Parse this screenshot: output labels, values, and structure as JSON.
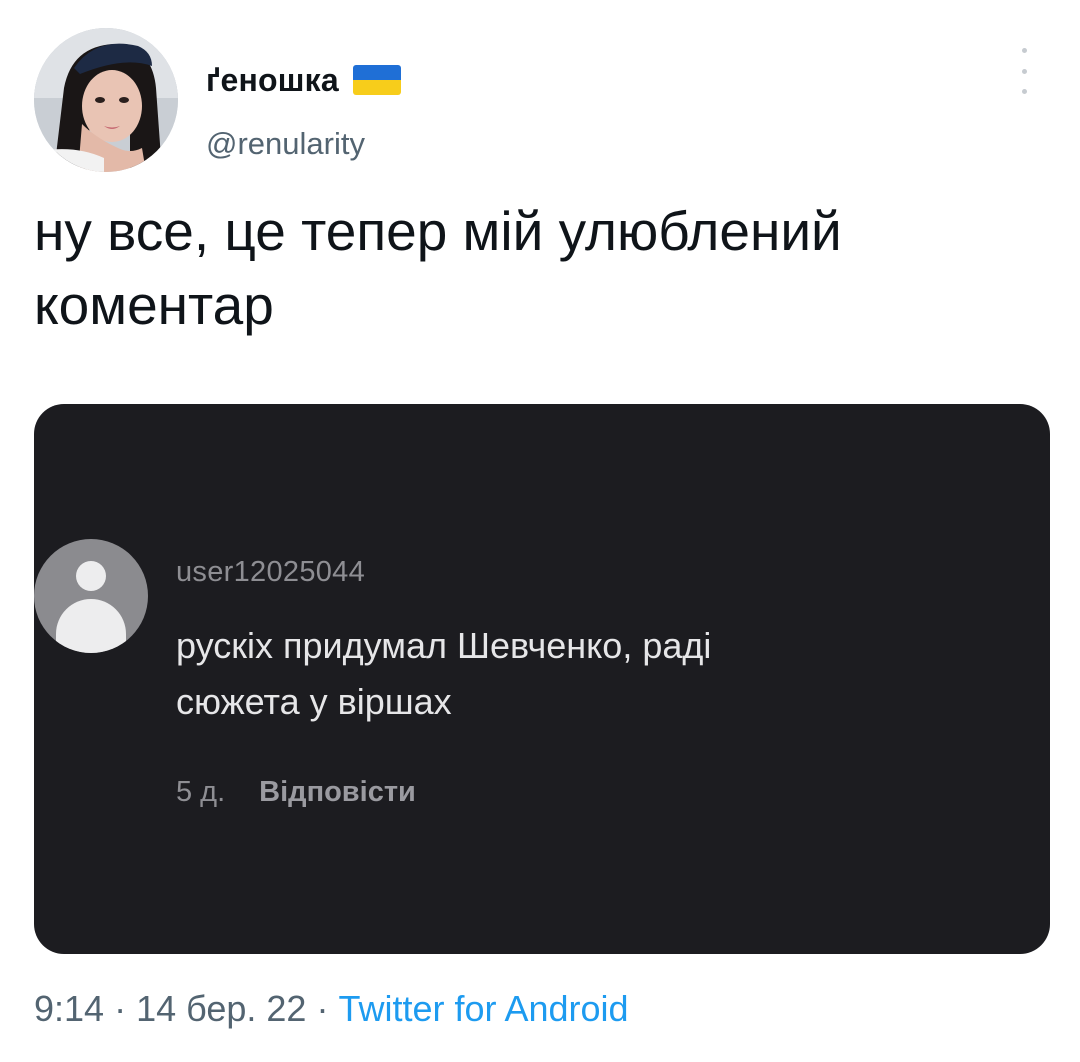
{
  "author": {
    "display_name": "ґеношка",
    "handle": "@renularity",
    "avatar_icon": "profile-photo",
    "flag_colors": [
      "#1f6fd6",
      "#f7cd1b"
    ]
  },
  "tweet": {
    "text": "ну все, це тепер мій улюблений\nкоментар"
  },
  "embedded_comment": {
    "username": "user12025044",
    "text": "рускіх придумал Шевченко, раді\nсюжета у віршах",
    "age": "5 д.",
    "reply_label": "Відповісти"
  },
  "footer": {
    "time": "9:14",
    "separator": " · ",
    "date": "14 бер. 22",
    "source": "Twitter for Android"
  },
  "colors": {
    "link": "#1d9bf0",
    "secondary_text": "#536471",
    "media_bg": "#1c1c20"
  }
}
